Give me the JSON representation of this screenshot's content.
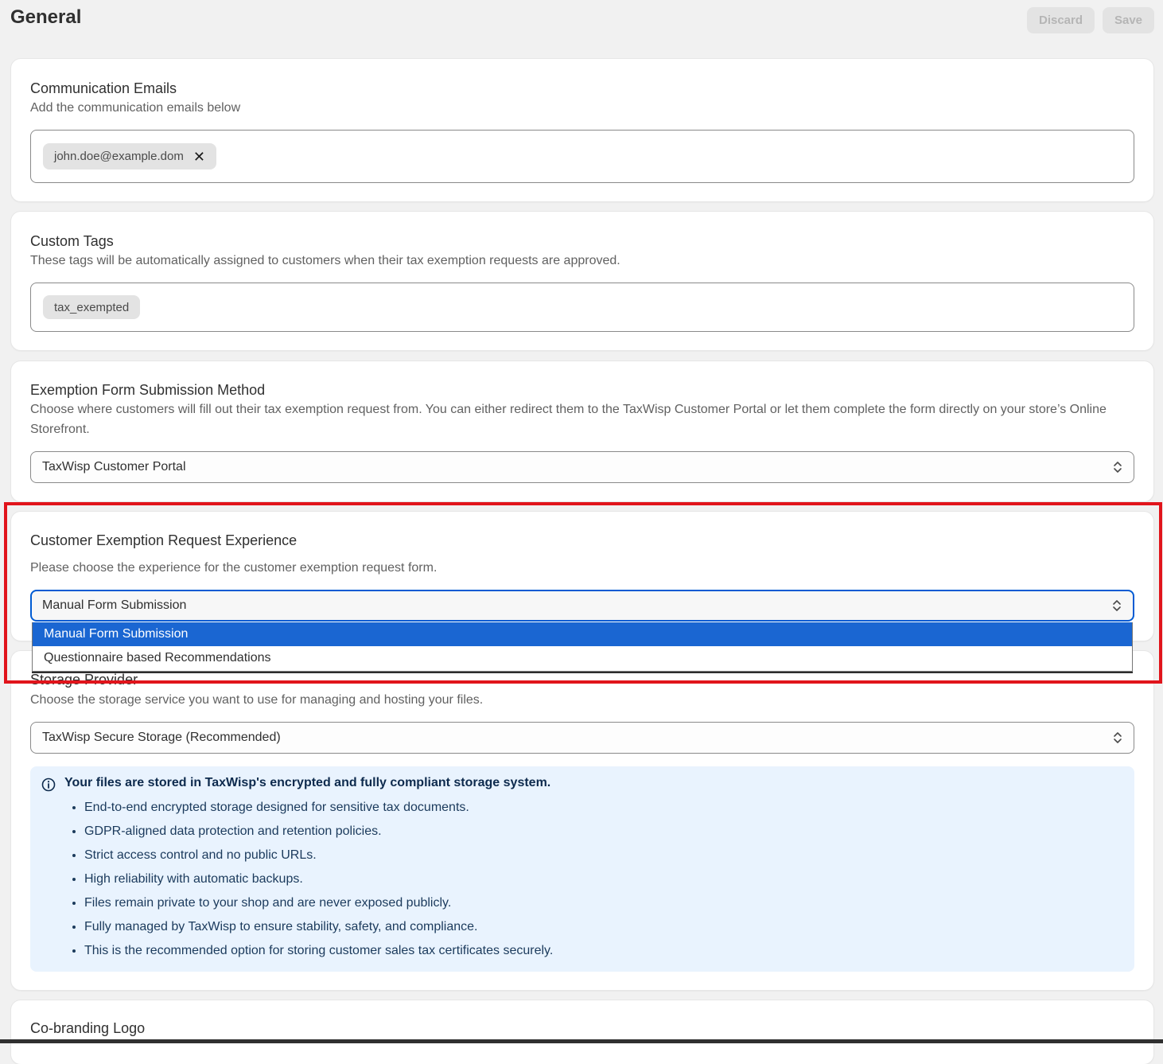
{
  "page": {
    "title": "General",
    "discard_label": "Discard",
    "save_label": "Save"
  },
  "communication_emails": {
    "title": "Communication Emails",
    "description": "Add the communication emails below",
    "emails": [
      "john.doe@example.dom"
    ],
    "remove_symbol": "✕"
  },
  "custom_tags": {
    "title": "Custom Tags",
    "description": "These tags will be automatically assigned to customers when their tax exemption requests are approved.",
    "tags": [
      "tax_exempted"
    ]
  },
  "submission_method": {
    "title": "Exemption Form Submission Method",
    "description": "Choose where customers will fill out their tax exemption request from. You can either redirect them to the TaxWisp Customer Portal or let them complete the form directly on your store’s Online Storefront.",
    "selected": "TaxWisp Customer Portal"
  },
  "request_experience": {
    "title": "Customer Exemption Request Experience",
    "description": "Please choose the experience for the customer exemption request form.",
    "selected": "Manual Form Submission",
    "options": [
      "Manual Form Submission",
      "Questionnaire based Recommendations"
    ]
  },
  "storage_provider": {
    "title": "Storage Provider",
    "description": "Choose the storage service you want to use for managing and hosting your files.",
    "selected": "TaxWisp Secure Storage (Recommended)",
    "info_heading": "Your files are stored in TaxWisp's encrypted and fully compliant storage system.",
    "info_points": [
      "End-to-end encrypted storage designed for sensitive tax documents.",
      "GDPR-aligned data protection and retention policies.",
      "Strict access control and no public URLs.",
      "High reliability with automatic backups.",
      "Files remain private to your shop and are never exposed publicly.",
      "Fully managed by TaxWisp to ensure stability, safety, and compliance.",
      "This is the recommended option for storing customer sales tax certificates securely."
    ]
  },
  "cobranding": {
    "title": "Co-branding Logo"
  },
  "colors": {
    "accent": "#005bd3",
    "dropdown_selected": "#1a66d2",
    "highlight": "#e1141b",
    "info_bg": "#e9f3fe"
  }
}
